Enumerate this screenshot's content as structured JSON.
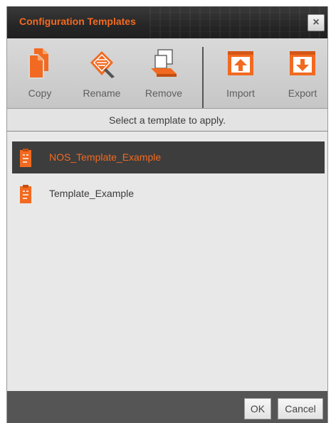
{
  "dialog": {
    "title": "Configuration Templates",
    "close_glyph": "×"
  },
  "toolbar": {
    "buttons": [
      {
        "label": "Copy",
        "icon": "copy-icon"
      },
      {
        "label": "Rename",
        "icon": "rename-icon"
      },
      {
        "label": "Remove",
        "icon": "remove-icon"
      },
      {
        "label": "Import",
        "icon": "import-icon"
      },
      {
        "label": "Export",
        "icon": "export-icon"
      }
    ]
  },
  "hint": "Select a template to apply.",
  "templates": [
    {
      "name": "NOS_Template_Example",
      "selected": true,
      "icon": "template-file-icon"
    },
    {
      "name": "Template_Example",
      "selected": false,
      "icon": "template-file-icon"
    }
  ],
  "footer": {
    "ok_label": "OK",
    "cancel_label": "Cancel"
  },
  "colors": {
    "accent": "#f26a21",
    "titlebar": "#262626",
    "selected_row": "#3d3d3d",
    "footer": "#555555"
  }
}
